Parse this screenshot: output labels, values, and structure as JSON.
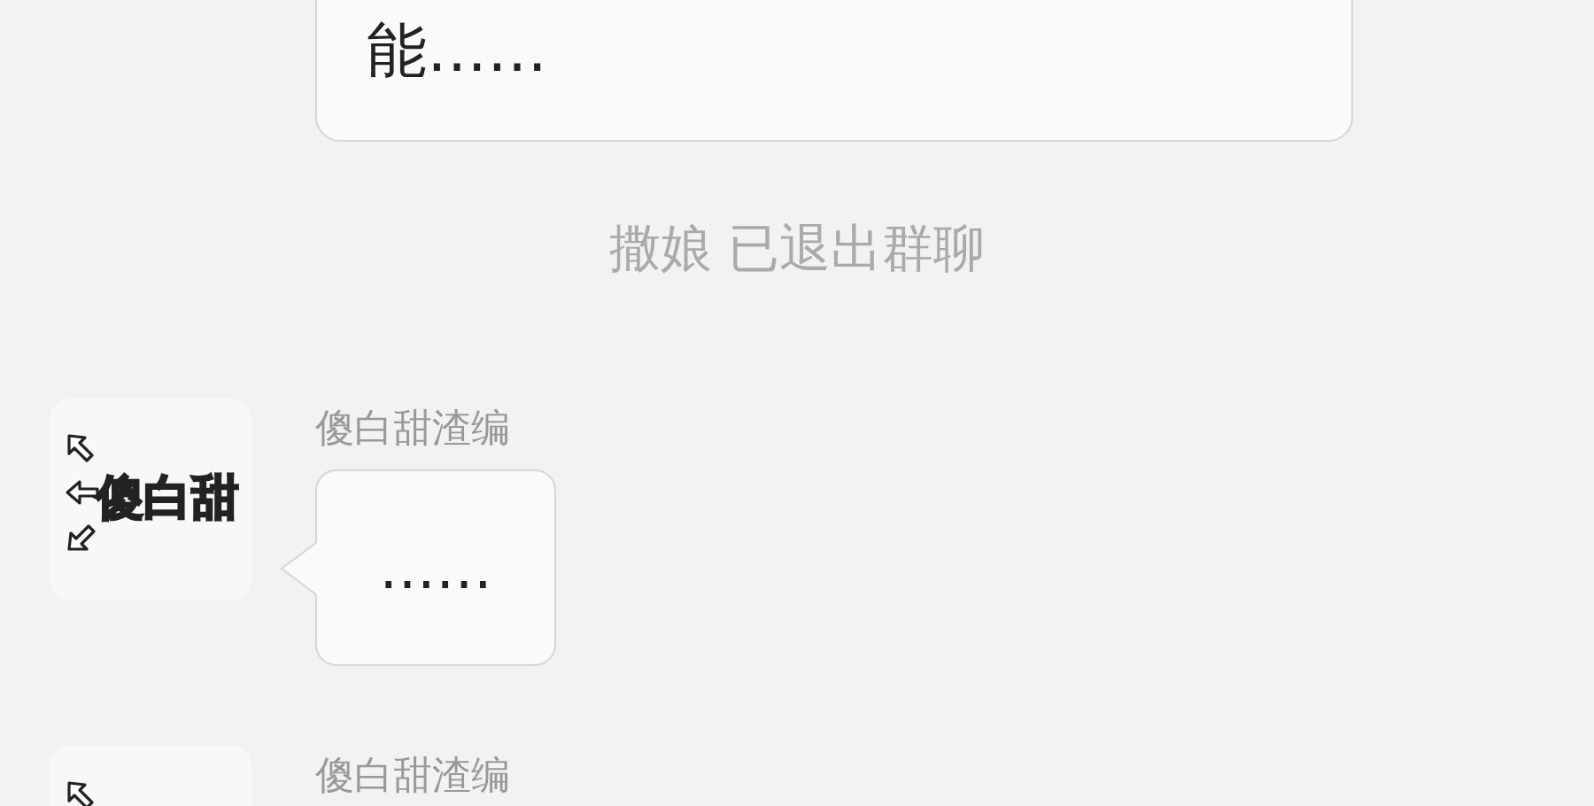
{
  "messages": [
    {
      "kind": "bubble",
      "text": "能……"
    },
    {
      "kind": "system",
      "text": "撒娘 已退出群聊"
    },
    {
      "kind": "message",
      "sender": "傻白甜渣编",
      "avatar_text": "傻白甜",
      "text": "……"
    },
    {
      "kind": "message",
      "sender": "傻白甜渣编"
    }
  ]
}
